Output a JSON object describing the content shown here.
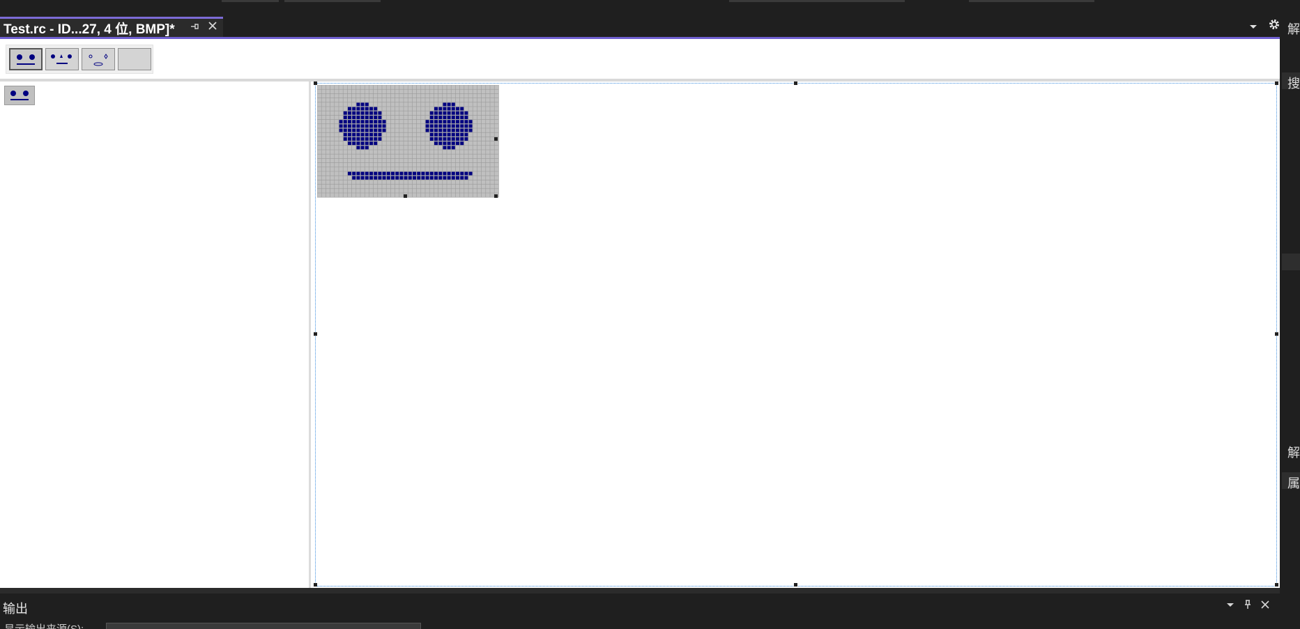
{
  "tab": {
    "title": "Test.rc - ID...27, 4 位, BMP]*",
    "pin_icon": "pin-icon",
    "close_icon": "close-icon",
    "menu_icon": "chevron-down-icon",
    "settings_icon": "gear-icon"
  },
  "toolbar": {
    "buttons": [
      {
        "name": "eyes-mouth",
        "selected": true
      },
      {
        "name": "eyes-nose-mouth",
        "selected": false
      },
      {
        "name": "small-face",
        "selected": false
      },
      {
        "name": "blank",
        "selected": false
      }
    ]
  },
  "bitmap": {
    "background_color": "#c0c0c0",
    "pixel_color": "#000080",
    "grid_color": "#9a9a9a"
  },
  "right_dock": {
    "labels": [
      "解",
      "搜",
      "解",
      "属"
    ]
  },
  "output": {
    "title": "输出",
    "source_label": "显示输出来源(S):",
    "menu_icon": "chevron-down-icon",
    "pin_icon": "pin-icon",
    "close_icon": "close-icon"
  },
  "colors": {
    "accent": "#6f5fd0",
    "selection": "#3d8ee0",
    "dark_bg": "#1f1f1f"
  }
}
